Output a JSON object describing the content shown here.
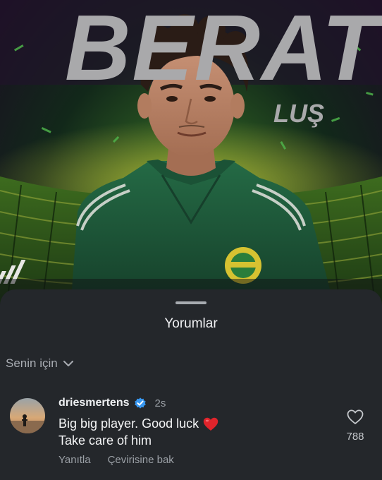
{
  "poster": {
    "name_big": "BERAT",
    "name_small": "LUŞ",
    "brand_colors": {
      "text": "#a9a9ab",
      "jersey": "#1f5a3c",
      "stadium_glow": "#7a7b1a"
    }
  },
  "sheet": {
    "title": "Yorumlar",
    "filter_label": "Senin için"
  },
  "comment": {
    "username": "driesmertens",
    "verified": true,
    "timestamp": "2s",
    "text_line1": "Big big player. Good luck",
    "emoji": "❤️",
    "text_line2": "Take care of him",
    "reply_label": "Yanıtla",
    "translate_label": "Çevirisine bak",
    "like_count": "788"
  },
  "colors": {
    "sheet_bg": "#24272b",
    "verified_badge": "#3897f0",
    "heart_emoji": "#e0242b"
  }
}
